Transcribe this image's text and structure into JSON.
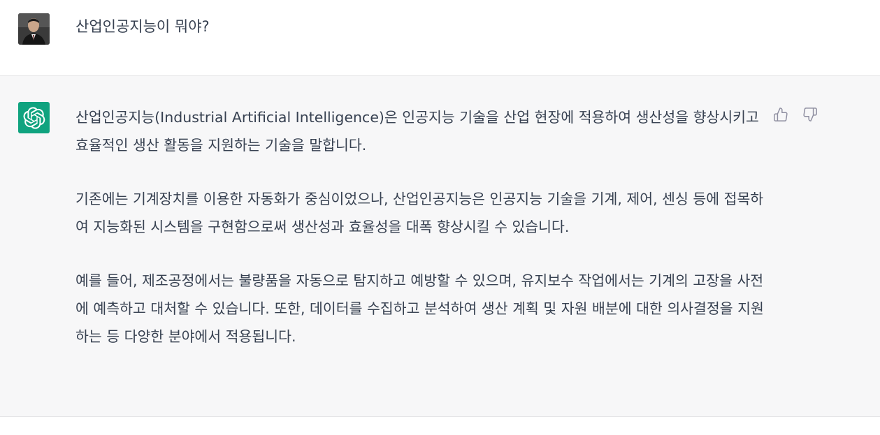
{
  "user_message": {
    "text": "산업인공지능이 뭐야?",
    "avatar": "user-photo-avatar"
  },
  "assistant_message": {
    "avatar": "openai-logo-icon",
    "avatar_color": "#10a37f",
    "paragraphs": [
      "산업인공지능(Industrial Artificial Intelligence)은 인공지능 기술을 산업 현장에 적용하여 생산성을 향상시키고 효율적인 생산 활동을 지원하는 기술을 말합니다.",
      "기존에는 기계장치를 이용한 자동화가 중심이었으나, 산업인공지능은 인공지능 기술을 기계, 제어, 센싱 등에 접목하여 지능화된 시스템을 구현함으로써 생산성과 효율성을 대폭 향상시킬 수 있습니다.",
      "예를 들어, 제조공정에서는 불량품을 자동으로 탐지하고 예방할 수 있으며, 유지보수 작업에서는 기계의 고장을 사전에 예측하고 대처할 수 있습니다. 또한, 데이터를 수집하고 분석하여 생산 계획 및 자원 배분에 대한 의사결정을 지원하는 등 다양한 분야에서 적용됩니다."
    ],
    "feedback": {
      "like_icon": "thumbs-up-icon",
      "dislike_icon": "thumbs-down-icon"
    }
  },
  "colors": {
    "user_row_bg": "#ffffff",
    "assistant_row_bg": "#f7f7f8",
    "text": "#374151",
    "icon": "#8e8ea0"
  }
}
